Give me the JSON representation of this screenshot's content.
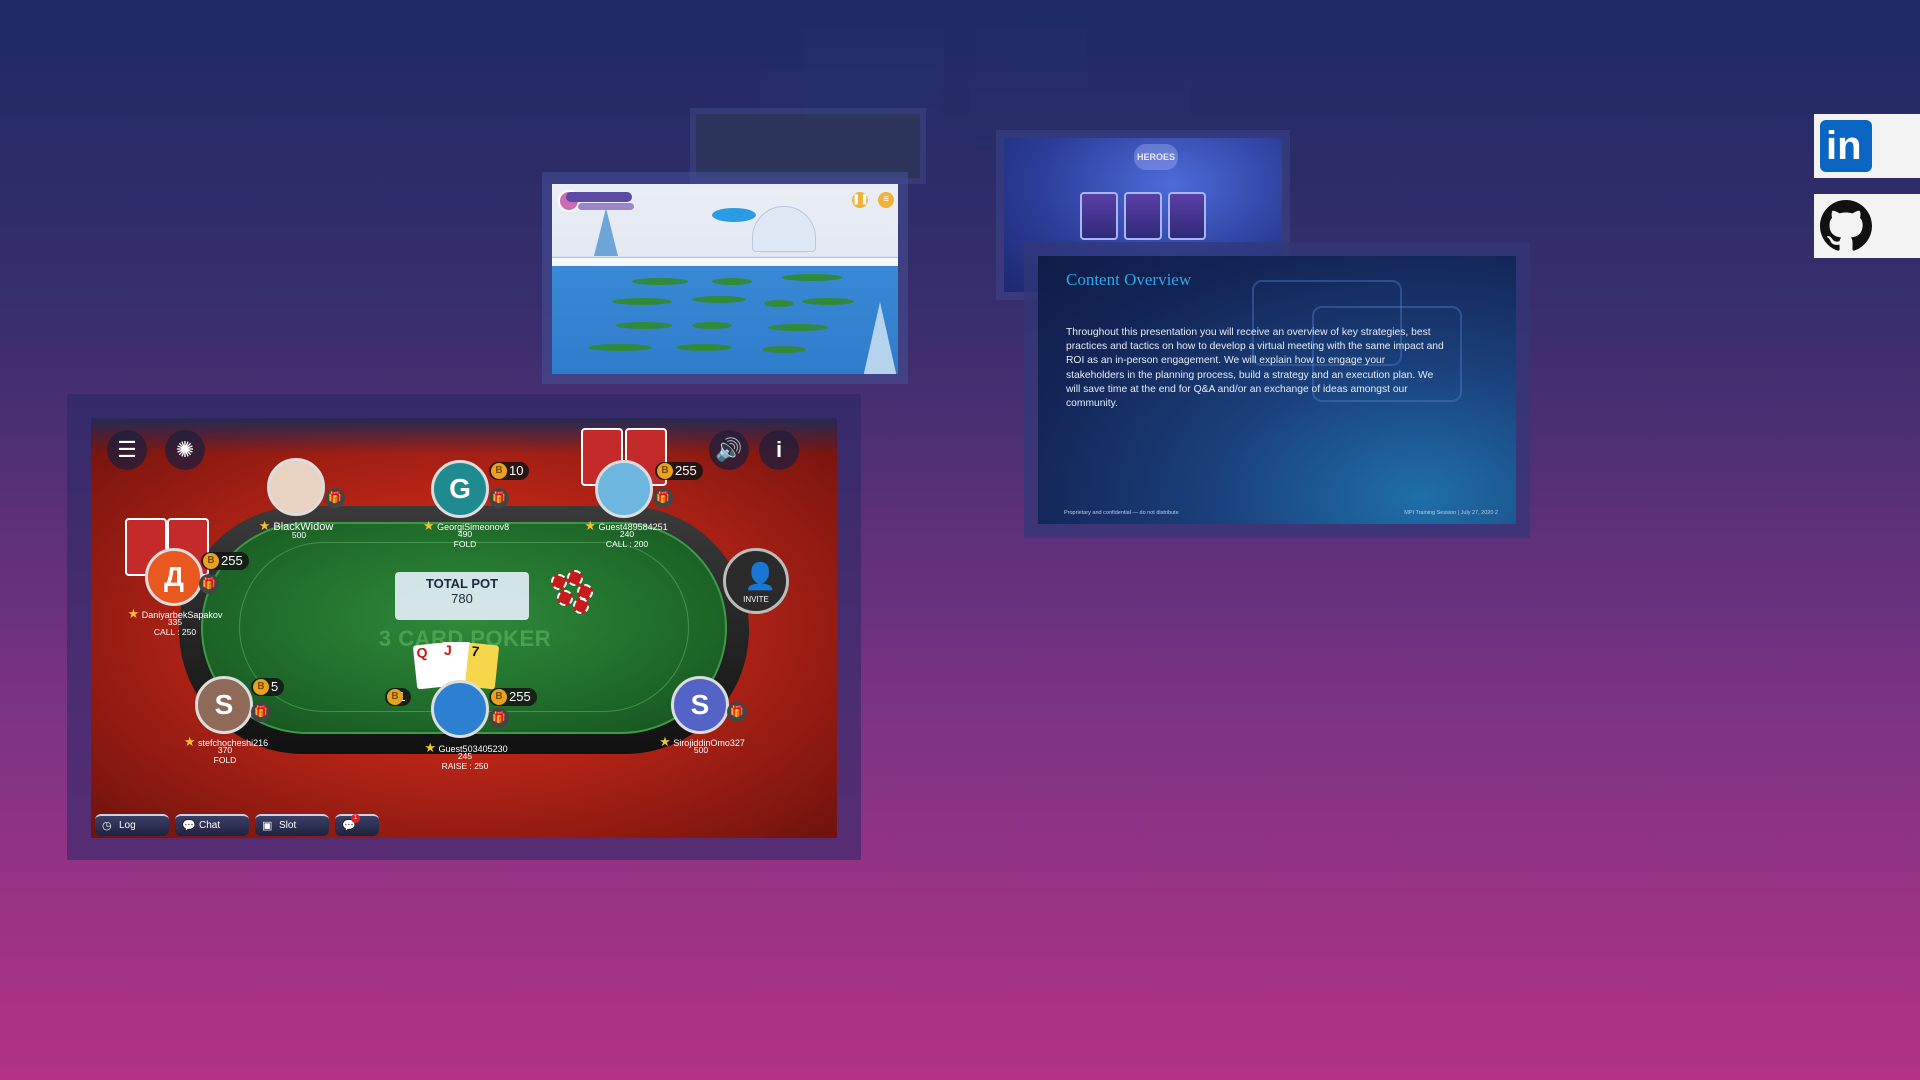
{
  "snow_game": {
    "pause_icon": "pause-icon",
    "menu_icon": "list-icon"
  },
  "fantasy_game": {
    "logo": "HEROES"
  },
  "presentation": {
    "title": "Content Overview",
    "body": "Throughout this presentation you will receive an overview of key strategies, best practices and tactics on how to develop a virtual meeting with the same impact and ROI as an in-person engagement.  We will explain how to engage your stakeholders in the planning process, build a strategy and an execution plan.  We will save time at the end for Q&A and/or an exchange of ideas amongst our community.",
    "footer_left": "Proprietary and confidential — do not distribute",
    "footer_right": "MPI Training Session  |  July 27, 2020      2"
  },
  "poker": {
    "pot_label": "TOTAL POT",
    "pot_value": "780",
    "game_logo": "3 CARD POKER",
    "invite_label": "INVITE",
    "players": {
      "blackwidow": {
        "name": "BlackWidow",
        "chips": "500"
      },
      "georgi": {
        "initial": "G",
        "name": "GeorgiSimeonov8",
        "chips": "490",
        "action": "FOLD",
        "bet": "10"
      },
      "guest489": {
        "name": "Guest489584251",
        "chips": "240",
        "action": "CALL : 200",
        "bet": "255"
      },
      "daniyarbek": {
        "initial": "Д",
        "name": "DaniyarbekSapakov",
        "chips": "335",
        "action": "CALL : 250",
        "bet": "255"
      },
      "stefcho": {
        "initial": "S",
        "name": "stefchocheshi216",
        "chips": "370",
        "action": "FOLD",
        "bet": "5"
      },
      "guest503": {
        "name": "Guest503405230",
        "chips": "245",
        "action": "RAISE : 250",
        "bet": "255",
        "timer": "31"
      },
      "sirojiddin": {
        "initial": "S",
        "name": "SirojiddinOmo327",
        "chips": "500"
      }
    },
    "hand_cards": [
      "Q",
      "J",
      "7"
    ],
    "bottom": {
      "log": "Log",
      "chat": "Chat",
      "slot": "Slot",
      "notif_count": "1"
    }
  },
  "social": {
    "linkedin_label": "in"
  }
}
